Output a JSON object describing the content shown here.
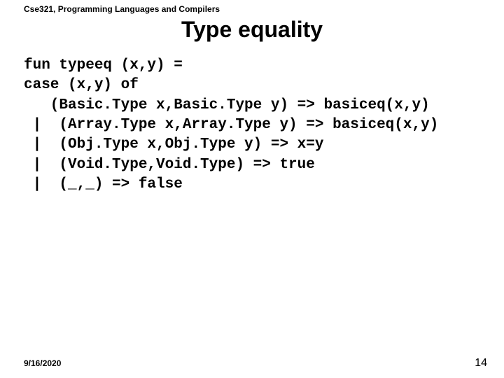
{
  "course_header": "Cse321, Programming Languages and Compilers",
  "title": "Type equality",
  "code": "fun typeeq (x,y) =\ncase (x,y) of\n   (Basic.Type x,Basic.Type y) => basiceq(x,y)\n |  (Array.Type x,Array.Type y) => basiceq(x,y)\n |  (Obj.Type x,Obj.Type y) => x=y\n |  (Void.Type,Void.Type) => true\n |  (_,_) => false",
  "footer": {
    "date": "9/16/2020",
    "page_number": "14"
  }
}
